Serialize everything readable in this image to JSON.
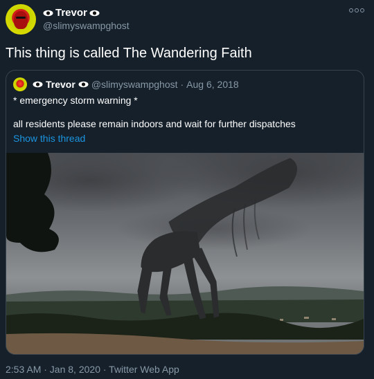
{
  "colors": {
    "background": "#15202b",
    "secondary_text": "#8899a6",
    "link": "#1b95e0",
    "border": "#38444d"
  },
  "author": {
    "display_name": "Trevor",
    "handle": "@slimyswampghost",
    "name_icons": [
      "eye-icon",
      "eye-icon"
    ]
  },
  "tweet": {
    "text": "This thing is called The Wandering Faith"
  },
  "quoted_tweet": {
    "display_name": "Trevor",
    "handle": "@slimyswampghost",
    "separator": "·",
    "date": "Aug 6, 2018",
    "line1": "* emergency storm warning *",
    "line2": "all residents please remain indoors and wait for further dispatches",
    "show_thread_label": "Show this thread"
  },
  "footer": {
    "meta": "2:53 AM · Jan 8, 2020 · Twitter Web App"
  }
}
